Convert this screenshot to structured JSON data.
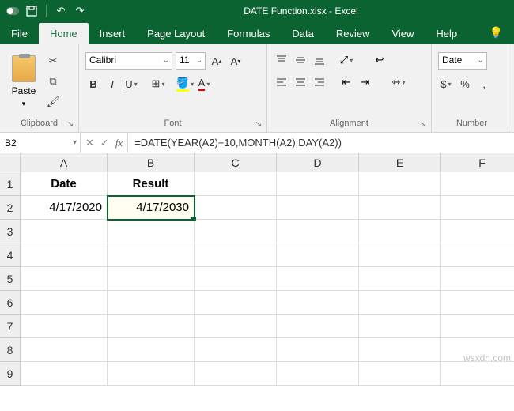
{
  "titlebar": {
    "doc_title": "DATE Function.xlsx - Excel"
  },
  "tabs": {
    "file": "File",
    "home": "Home",
    "insert": "Insert",
    "page_layout": "Page Layout",
    "formulas": "Formulas",
    "data": "Data",
    "review": "Review",
    "view": "View",
    "help": "Help"
  },
  "ribbon": {
    "clipboard": {
      "label": "Clipboard",
      "paste": "Paste"
    },
    "font": {
      "label": "Font",
      "name": "Calibri",
      "size": "11"
    },
    "alignment": {
      "label": "Alignment"
    },
    "number": {
      "label": "Number",
      "format": "Date"
    }
  },
  "fxrow": {
    "namebox": "B2",
    "formula": "=DATE(YEAR(A2)+10,MONTH(A2),DAY(A2))",
    "fx": "fx"
  },
  "grid": {
    "cols": [
      "A",
      "B",
      "C",
      "D",
      "E",
      "F"
    ],
    "rows": [
      "1",
      "2",
      "3",
      "4",
      "5",
      "6",
      "7",
      "8",
      "9"
    ],
    "headers": {
      "a1": "Date",
      "b1": "Result"
    },
    "a2": "4/17/2020",
    "b2": "4/17/2030"
  },
  "watermark": "wsxdn.com"
}
